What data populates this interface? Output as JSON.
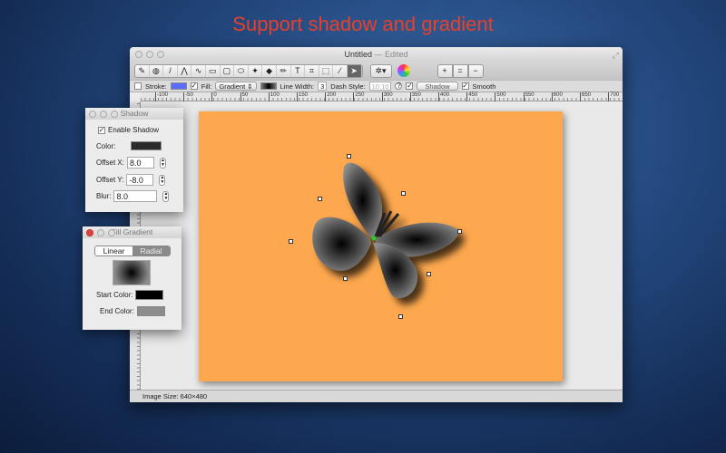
{
  "headline": "Support shadow and gradient",
  "window": {
    "title": "Untitled",
    "edited": "— Edited",
    "status": "Image Size: 640×480"
  },
  "toolbar": {
    "tools": [
      "eyedropper-icon",
      "paint-bucket-icon",
      "line-icon",
      "polyline-icon",
      "curve-icon",
      "rectangle-icon",
      "rounded-rect-icon",
      "ellipse-icon",
      "butterfly-shape-icon",
      "eraser-icon",
      "pencil-icon",
      "text-icon",
      "crop-icon",
      "marquee-icon",
      "magic-wand-icon",
      "pointer-icon"
    ],
    "tool_glyphs": [
      "✎",
      "◍",
      "/",
      "⋀",
      "∿",
      "▭",
      "▢",
      "⬭",
      "✦",
      "◆",
      "✏",
      "T",
      "⌗",
      "⬚",
      "⁄",
      "➤"
    ],
    "zoom_in": "+",
    "zoom_actual": "=",
    "zoom_out": "−"
  },
  "options": {
    "stroke_label": "Stroke:",
    "stroke_color": "#5b6cff",
    "fill_label": "Fill:",
    "fill_mode": "Gradient ⇕",
    "line_width_label": "Line Width:",
    "line_width": "3",
    "dash_label": "Dash Style:",
    "dash_value": "10:10",
    "help": "?",
    "shadow_label": "Shadow",
    "smooth_label": "Smooth"
  },
  "ruler": [
    "-100",
    "-50",
    "0",
    "50",
    "100",
    "150",
    "200",
    "250",
    "300",
    "350",
    "400",
    "450",
    "500",
    "550",
    "600",
    "650",
    "700"
  ],
  "shadow_panel": {
    "title": "Shadow",
    "enable": "Enable Shadow",
    "color_label": "Color:",
    "color": "#2a2a2a",
    "offset_x_label": "Offset  X:",
    "offset_x": "8.0",
    "offset_y_label": "Offset  Y:",
    "offset_y": "-8.0",
    "blur_label": "Blur:",
    "blur": "8.0"
  },
  "gradient_panel": {
    "title": "Fill Gradient",
    "linear": "Linear",
    "radial": "Radial",
    "start_label": "Start Color:",
    "start_color": "#000000",
    "end_label": "End Color:",
    "end_color": "#8c8c8c"
  },
  "canvas": {
    "background": "#fda84e"
  }
}
